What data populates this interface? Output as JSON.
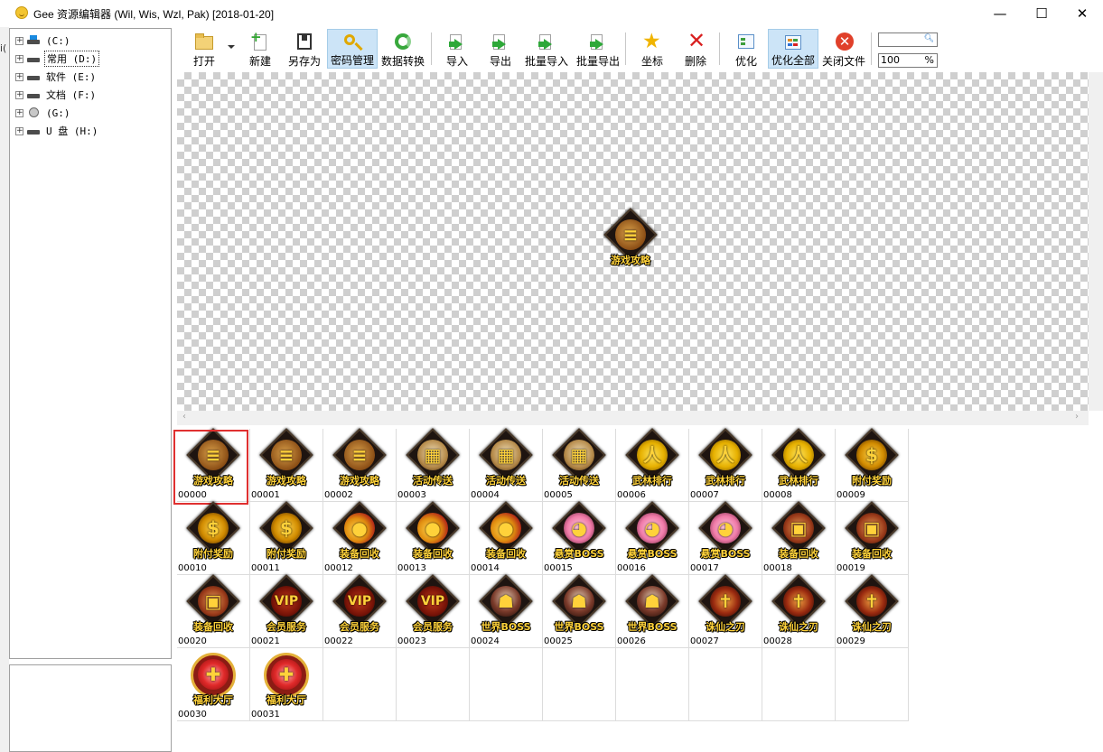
{
  "window": {
    "title": "Gee 资源编辑器 (Wil, Wis, Wzl, Pak) [2018-01-20]",
    "minimize": "—",
    "maximize": "☐",
    "close": "✕"
  },
  "left_edge_text": "i(",
  "tree": [
    {
      "label": "(C:)",
      "icon": "windows-drive-icon",
      "selected": false
    },
    {
      "label": "常用 (D:)",
      "icon": "drive-icon",
      "selected": true
    },
    {
      "label": "软件 (E:)",
      "icon": "drive-icon",
      "selected": false
    },
    {
      "label": "文档 (F:)",
      "icon": "drive-icon",
      "selected": false
    },
    {
      "label": "(G:)",
      "icon": "disc-drive-icon",
      "selected": false
    },
    {
      "label": "U 盘 (H:)",
      "icon": "drive-icon",
      "selected": false
    }
  ],
  "toolbar": {
    "open": "打开",
    "new": "新建",
    "save_as": "另存为",
    "password": "密码管理",
    "convert": "数据转换",
    "import": "导入",
    "export": "导出",
    "batch_import": "批量导入",
    "batch_export": "批量导出",
    "coords": "坐标",
    "delete": "删除",
    "optimize": "优化",
    "optimize_all": "优化全部",
    "close_file": "关闭文件",
    "search_value": "",
    "zoom_value": "100",
    "zoom_unit": "%"
  },
  "preview": {
    "label": "游戏攻略",
    "kind": "book"
  },
  "selected_index": 0,
  "images": [
    {
      "id": "00000",
      "label": "游戏攻略",
      "kind": "book"
    },
    {
      "id": "00001",
      "label": "游戏攻略",
      "kind": "book"
    },
    {
      "id": "00002",
      "label": "游戏攻略",
      "kind": "book"
    },
    {
      "id": "00003",
      "label": "活动传送",
      "kind": "board"
    },
    {
      "id": "00004",
      "label": "活动传送",
      "kind": "board"
    },
    {
      "id": "00005",
      "label": "活动传送",
      "kind": "board"
    },
    {
      "id": "00006",
      "label": "武林排行",
      "kind": "meditate"
    },
    {
      "id": "00007",
      "label": "武林排行",
      "kind": "meditate"
    },
    {
      "id": "00008",
      "label": "武林排行",
      "kind": "meditate"
    },
    {
      "id": "00009",
      "label": "附付奖励",
      "kind": "dollar"
    },
    {
      "id": "00010",
      "label": "附付奖励",
      "kind": "dollar"
    },
    {
      "id": "00011",
      "label": "附付奖励",
      "kind": "dollar"
    },
    {
      "id": "00012",
      "label": "装备回收",
      "kind": "coins"
    },
    {
      "id": "00013",
      "label": "装备回收",
      "kind": "coins"
    },
    {
      "id": "00014",
      "label": "装备回收",
      "kind": "coins"
    },
    {
      "id": "00015",
      "label": "悬赏BOSS",
      "kind": "pig"
    },
    {
      "id": "00016",
      "label": "悬赏BOSS",
      "kind": "pig"
    },
    {
      "id": "00017",
      "label": "悬赏BOSS",
      "kind": "pig"
    },
    {
      "id": "00018",
      "label": "装备回收",
      "kind": "chest"
    },
    {
      "id": "00019",
      "label": "装备回收",
      "kind": "chest"
    },
    {
      "id": "00020",
      "label": "装备回收",
      "kind": "chest"
    },
    {
      "id": "00021",
      "label": "会员服务",
      "kind": "vip"
    },
    {
      "id": "00022",
      "label": "会员服务",
      "kind": "vip"
    },
    {
      "id": "00023",
      "label": "会员服务",
      "kind": "vip"
    },
    {
      "id": "00024",
      "label": "世界BOSS",
      "kind": "warrior"
    },
    {
      "id": "00025",
      "label": "世界BOSS",
      "kind": "warrior"
    },
    {
      "id": "00026",
      "label": "世界BOSS",
      "kind": "warrior"
    },
    {
      "id": "00027",
      "label": "诛仙之刃",
      "kind": "sword"
    },
    {
      "id": "00028",
      "label": "诛仙之刃",
      "kind": "sword"
    },
    {
      "id": "00029",
      "label": "诛仙之刃",
      "kind": "sword"
    },
    {
      "id": "00030",
      "label": "福利大厅",
      "kind": "gift"
    },
    {
      "id": "00031",
      "label": "福利大厅",
      "kind": "gift"
    }
  ],
  "symbols": {
    "book": "≡",
    "board": "▦",
    "meditate": "人",
    "dollar": "$",
    "coins": "●",
    "pig": "◕",
    "chest": "▣",
    "vip": "VIP",
    "warrior": "☗",
    "sword": "✝",
    "gift": "✚"
  },
  "colors": {
    "selection_border": "#e03030",
    "active_toolbar": "#cce4f7",
    "sprite_text": "#ffd23a"
  }
}
